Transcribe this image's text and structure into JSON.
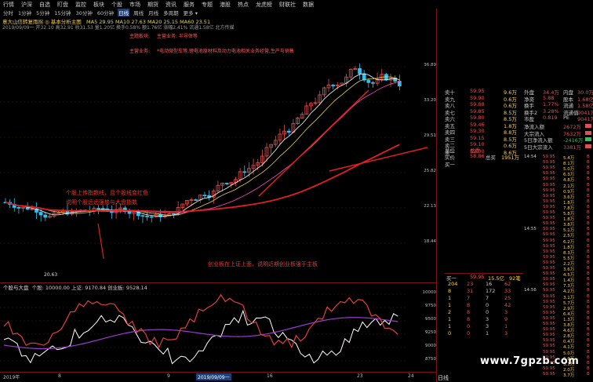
{
  "menu": [
    "行情",
    "沪深",
    "自选",
    "盯盘",
    "监控",
    "板块",
    "个股",
    "市场",
    "期货",
    "资讯",
    "服务",
    "专题",
    "港股",
    "热点",
    "龙虎榜",
    "财联社",
    "数据"
  ],
  "timeframes": [
    {
      "label": "分时",
      "active": false
    },
    {
      "label": "1分钟",
      "active": false
    },
    {
      "label": "5分钟",
      "active": false
    },
    {
      "label": "15分钟",
      "active": false
    },
    {
      "label": "30分钟",
      "active": false
    },
    {
      "label": "60分钟",
      "active": false
    },
    {
      "label": "日线",
      "active": true
    },
    {
      "label": "周线",
      "active": false
    },
    {
      "label": "月线",
      "active": false
    },
    {
      "label": "多周期",
      "active": false
    },
    {
      "label": "更多 ▾",
      "active": false
    }
  ],
  "stock": {
    "name_line": "意大山信转复雨拐 ◎ 基本分析主图",
    "ma_line": "MA5 29.95  MA10 27.63  MA20 25.15  MA60 23.51",
    "info_line": "2019/09/09一 开32.10 高32.91 收31.53 量1.20亿 换手0.58% 额1.76亿 涨幅2.41% 流通1.58亿 北方传媒",
    "tag1": "主题板块:",
    "tag2": "主营业务:  半导体等",
    "tag3": "主营业务:",
    "tag4": "*电动微型车等,锂电池原材料及动力电池相关业务经营,生产与销售"
  },
  "annotations": {
    "a1": "个股上传指数线，且个股线变红色",
    "a2": "说明个股远远强势与大盘指数",
    "a3": "创业板在上证上面，说明近期创业板强于主板"
  },
  "indicator": {
    "title": "个股与大盘",
    "params": "个股: 10000.00  上证: 9170.84  创业板: 9528.14"
  },
  "price_axis": [
    "36.89",
    "33.20",
    "29.51",
    "25.82",
    "22.13",
    "18.44"
  ],
  "ind_axis": [
    "10000",
    "9750",
    "9500",
    "9250",
    "9000",
    "8750"
  ],
  "date_axis": [
    "2019年",
    "8",
    "9",
    "2019/09/09一",
    "16",
    "23",
    "24"
  ],
  "low_price_label": "20.63",
  "orderbook": [
    {
      "label": "卖十",
      "price": "59.95",
      "vol": "9.6万",
      "c": "#e05050"
    },
    {
      "label": "卖九",
      "price": "59.90",
      "vol": "0.6万",
      "c": "#e05050"
    },
    {
      "label": "卖八",
      "price": "59.88",
      "vol": "0.6万",
      "c": "#e05050"
    },
    {
      "label": "卖七",
      "price": "59.85",
      "vol": "8.5万",
      "c": "#e05050"
    },
    {
      "label": "卖六",
      "price": "59.80",
      "vol": "8.5万",
      "c": "#e05050"
    },
    {
      "label": "卖五",
      "price": "59.46",
      "vol": "1.8万",
      "c": "#e05050"
    },
    {
      "label": "卖四",
      "price": "59.30",
      "vol": "8.8万",
      "c": "#e05050"
    },
    {
      "label": "卖三",
      "price": "59.15",
      "vol": "8.5万",
      "c": "#e05050"
    },
    {
      "label": "卖二",
      "price": "59.10",
      "vol": "0.6万",
      "c": "#e05050"
    },
    {
      "label": "卖一",
      "price": "59.00",
      "vol": "8.6万",
      "c": "#e05050"
    }
  ],
  "quote_top": [
    {
      "label": "外盘",
      "v1": "34.4万",
      "label2": "内盘",
      "v2": "30.0万"
    },
    {
      "label": "净资",
      "v1": "5.88",
      "label2": "股本",
      "v2": "1.68亿"
    },
    {
      "label": "换手",
      "v1": "1.77%",
      "label2": "流通",
      "v2": "1.58亿"
    },
    {
      "label": "换手2",
      "v1": "3.28%",
      "label2": "流通值",
      "v2": "9041万"
    },
    {
      "label": "市盈",
      "v1": "0.819",
      "label2": "PE",
      "v2": "9041万"
    }
  ],
  "flows": [
    {
      "label": "净流入额",
      "val": "2672万",
      "c": "#e05050"
    },
    {
      "label": "大宗流入",
      "val": "7632万",
      "c": "#e05050"
    },
    {
      "label": "5日净流入额",
      "val": "-2416万",
      "c": "#33c05a"
    },
    {
      "label": "5日大宗流入",
      "val": "3381万",
      "c": "#e05050"
    }
  ],
  "summary": [
    {
      "label": "总价",
      "v": "总委"
    },
    {
      "label": "实价",
      "v": "58.86",
      "label2": "总买",
      "v2": "1951万"
    },
    {
      "label": "买一",
      "v": ""
    }
  ],
  "trades": [
    {
      "t": "14:54",
      "p": "59.95",
      "v": "5.4万"
    },
    {
      "t": "",
      "p": "59.95",
      "v": "8.1万"
    },
    {
      "t": "",
      "p": "59.95",
      "v": "5.0万"
    },
    {
      "t": "",
      "p": "59.95",
      "v": "6.3万"
    },
    {
      "t": "",
      "p": "59.95",
      "v": "4.8万"
    },
    {
      "t": "",
      "p": "59.95",
      "v": "2.1万"
    },
    {
      "t": "",
      "p": "59.95",
      "v": "0.9万"
    },
    {
      "t": "",
      "p": "59.95",
      "v": "3.6万"
    },
    {
      "t": "",
      "p": "59.95",
      "v": "1.8万"
    },
    {
      "t": "",
      "p": "59.95",
      "v": "7.8万"
    },
    {
      "t": "",
      "p": "59.95",
      "v": "5.8万"
    },
    {
      "t": "",
      "p": "59.95",
      "v": "1.8万"
    },
    {
      "t": "",
      "p": "59.95",
      "v": "3.8万"
    },
    {
      "t": "14:55",
      "p": "59.95",
      "v": "5.1万"
    },
    {
      "t": "",
      "p": "59.95",
      "v": "2.5万"
    },
    {
      "t": "",
      "p": "59.95",
      "v": "6.2万"
    },
    {
      "t": "",
      "p": "59.95",
      "v": "1.8万"
    },
    {
      "t": "",
      "p": "59.95",
      "v": "8.3万"
    },
    {
      "t": "",
      "p": "59.95",
      "v": "5.5万"
    },
    {
      "t": "",
      "p": "59.95",
      "v": "2.2万"
    },
    {
      "t": "",
      "p": "59.95",
      "v": "3.6万"
    },
    {
      "t": "",
      "p": "59.95",
      "v": "4.5万"
    },
    {
      "t": "",
      "p": "59.95",
      "v": "1.4万"
    },
    {
      "t": "",
      "p": "59.95",
      "v": "7.3万"
    },
    {
      "t": "14:56",
      "p": "59.95",
      "v": "4.2万"
    },
    {
      "t": "",
      "p": "59.95",
      "v": "3.1万"
    },
    {
      "t": "",
      "p": "59.95",
      "v": "5.7万"
    },
    {
      "t": "",
      "p": "59.95",
      "v": "2.9万"
    },
    {
      "t": "",
      "p": "59.95",
      "v": "6.4万"
    },
    {
      "t": "",
      "p": "59.95",
      "v": "1.3万"
    },
    {
      "t": "",
      "p": "59.95",
      "v": "3.8万"
    },
    {
      "t": "",
      "p": "59.95",
      "v": "4.6万"
    },
    {
      "t": "",
      "p": "59.95",
      "v": "2.8万"
    },
    {
      "t": "",
      "p": "59.95",
      "v": "0.4万"
    },
    {
      "t": "",
      "p": "59.95",
      "v": "4.1万"
    },
    {
      "t": "",
      "p": "59.95",
      "v": "5.0万"
    },
    {
      "t": "",
      "p": "59.95",
      "v": "6.6万"
    },
    {
      "t": "",
      "p": "59.95",
      "v": "3.1万"
    },
    {
      "t": "",
      "p": "59.95",
      "v": "2.0万"
    },
    {
      "t": "",
      "p": "59.95",
      "v": "3.7万"
    }
  ],
  "buy_summary": {
    "label": "买一",
    "price": "59.95",
    "vol": "15.5亿",
    "pct": "92笔"
  },
  "small_table": [
    [
      "204",
      "23",
      "16",
      "62"
    ],
    [
      "8",
      "31",
      "172",
      "33"
    ],
    [
      "1",
      "7",
      "7",
      "25"
    ],
    [
      "1",
      "8",
      "0",
      "42"
    ],
    [
      "2",
      "8",
      "0",
      "3"
    ],
    [
      "1",
      "8",
      "3",
      "9"
    ],
    [
      "1",
      "0",
      "3",
      "1"
    ],
    [
      "0",
      "0",
      "1",
      "3"
    ]
  ],
  "bottom_right": "日线",
  "watermark": "www.7gpzb.com",
  "colors": {
    "up": "#e05050",
    "down": "#33c05a",
    "ma5": "#ffffff",
    "ma10": "#e6d34a",
    "ma20": "#ff4cc2",
    "ma60": "#e02020",
    "stock_line": "#e04040",
    "index_line": "#ffffff",
    "gem_line": "#9a3ccf"
  }
}
